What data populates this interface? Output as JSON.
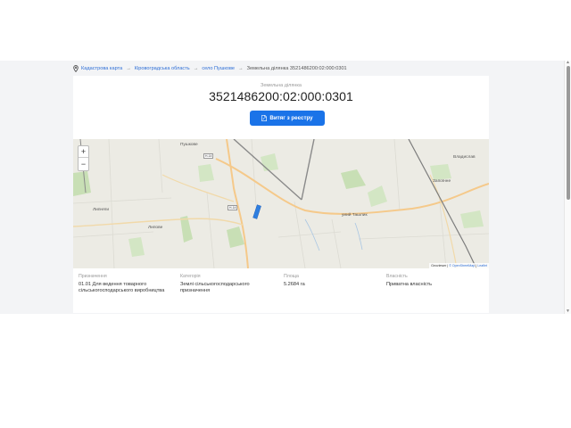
{
  "breadcrumb": {
    "items": [
      {
        "label": "Кадастрова карта"
      },
      {
        "label": "Кіровоградська область"
      },
      {
        "label": "село Пушкове"
      }
    ],
    "separator": "→",
    "current": "Земельна ділянка 3521486200:02:000:0301"
  },
  "parcel": {
    "kicker": "Земельна ділянка",
    "cadastral_number": "3521486200:02:000:0301",
    "extract_button": "Витяг з реєстру"
  },
  "map": {
    "zoom_in": "+",
    "zoom_out": "−",
    "labels": {
      "pushkove": "Пушкове",
      "vladyslav": "Владислав",
      "zapoinye": "Запоїнне",
      "lypnyaky": "Липняги",
      "lypove": "Липове",
      "tashyk": "уиий Ташлик"
    },
    "road_shields": {
      "upper": "Н-14",
      "lower": "Н-14"
    },
    "attribution": {
      "provider": "Geoviewer",
      "osm": "© OpenStreetMap",
      "leaflet": "Leaflet",
      "separator": "|"
    },
    "colors": {
      "background": "#ecebe4",
      "field_green": "#c8dfb5",
      "road_main": "#f5c98a",
      "parcel": "#2f7fe0"
    }
  },
  "details": {
    "purpose": {
      "label": "Призначення",
      "value": "01.01 Для ведення товарного сільськогосподарського виробництва"
    },
    "category": {
      "label": "Категорія",
      "value": "Землі сільськогосподарського призначення"
    },
    "area": {
      "label": "Площа",
      "value": "5.2684 га"
    },
    "ownership": {
      "label": "Власність",
      "value": "Приватна власність"
    }
  },
  "colors": {
    "accent": "#1a73e8",
    "link": "#2f6fd6"
  }
}
